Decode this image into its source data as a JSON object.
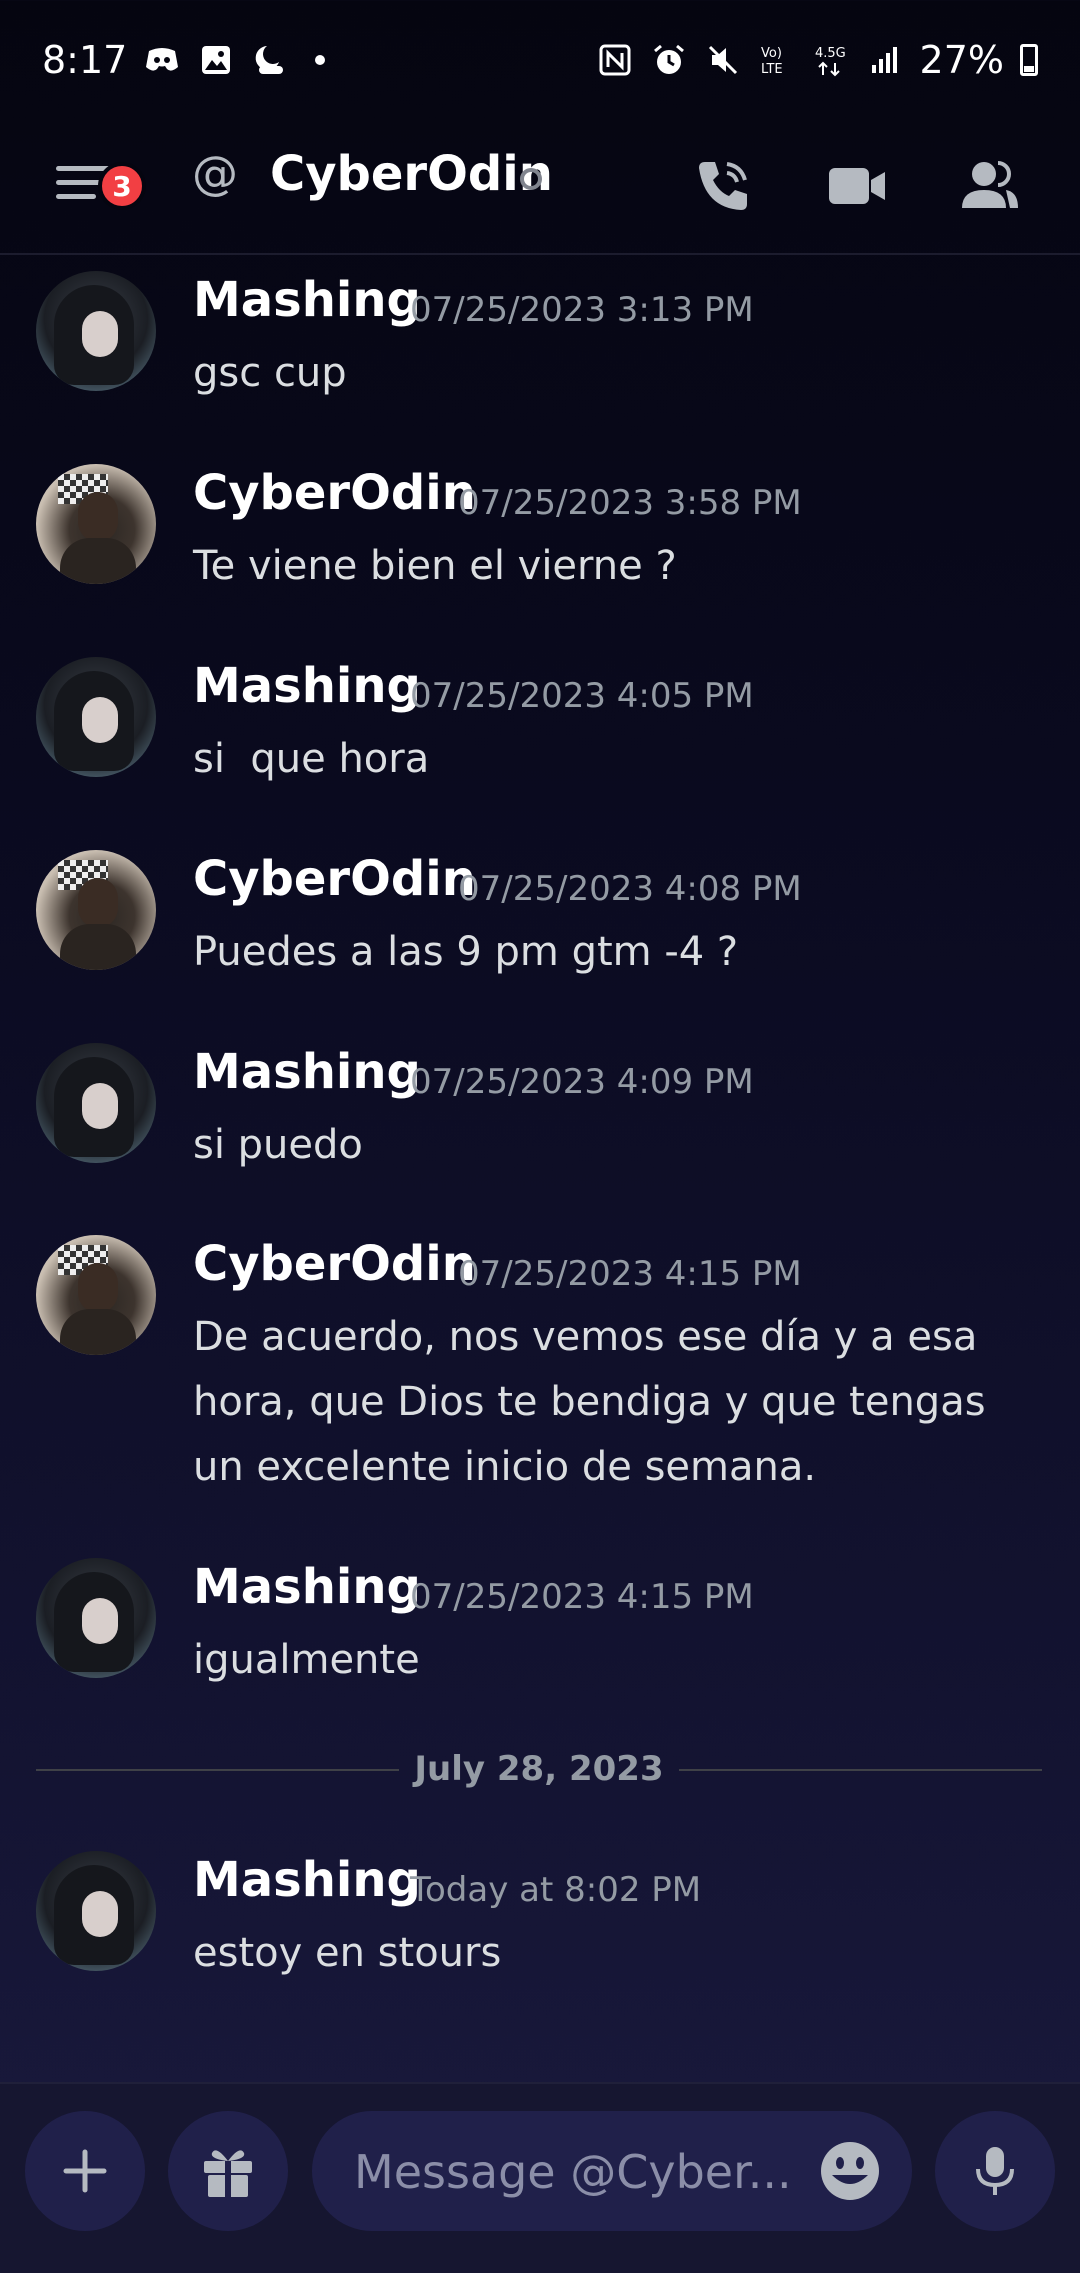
{
  "status_bar": {
    "time": "8:17",
    "battery": "27%"
  },
  "header": {
    "badge_count": "3",
    "channel_name": "CyberOdin",
    "at_symbol": "@"
  },
  "messages": [
    {
      "author": "Mashing",
      "timestamp": "07/25/2023 3:13 PM",
      "content": "gsc cup",
      "avatar": "mashing"
    },
    {
      "author": "CyberOdin",
      "timestamp": "07/25/2023 3:58 PM",
      "content": "Te viene bien el vierne ?",
      "avatar": "cyberodin"
    },
    {
      "author": "Mashing",
      "timestamp": "07/25/2023 4:05 PM",
      "content": "si  que hora",
      "avatar": "mashing"
    },
    {
      "author": "CyberOdin",
      "timestamp": "07/25/2023 4:08 PM",
      "content": "Puedes a las 9 pm gtm -4 ?",
      "avatar": "cyberodin"
    },
    {
      "author": "Mashing",
      "timestamp": "07/25/2023 4:09 PM",
      "content": "si puedo",
      "avatar": "mashing"
    },
    {
      "author": "CyberOdin",
      "timestamp": "07/25/2023 4:15 PM",
      "content": "De acuerdo, nos vemos ese día y a esa hora, que Dios te bendiga y que tengas un excelente inicio de semana.",
      "avatar": "cyberodin"
    },
    {
      "author": "Mashing",
      "timestamp": "07/25/2023 4:15 PM",
      "content": "igualmente",
      "avatar": "mashing"
    },
    {
      "author": "Mashing",
      "timestamp": "Today at 8:02 PM",
      "content": "estoy en stours",
      "avatar": "mashing"
    }
  ],
  "date_divider": "July 28, 2023",
  "composer": {
    "placeholder": "Message @Cyber..."
  },
  "icons": {
    "menu": "menu-icon",
    "call": "phone-call-icon",
    "video": "video-camera-icon",
    "members": "members-icon",
    "add": "plus-icon",
    "gift": "gift-icon",
    "emoji": "emoji-icon",
    "mic": "microphone-icon"
  },
  "colors": {
    "badge": "#f23f43",
    "timestamp": "#949ba4",
    "input_bg": "#20204a"
  }
}
